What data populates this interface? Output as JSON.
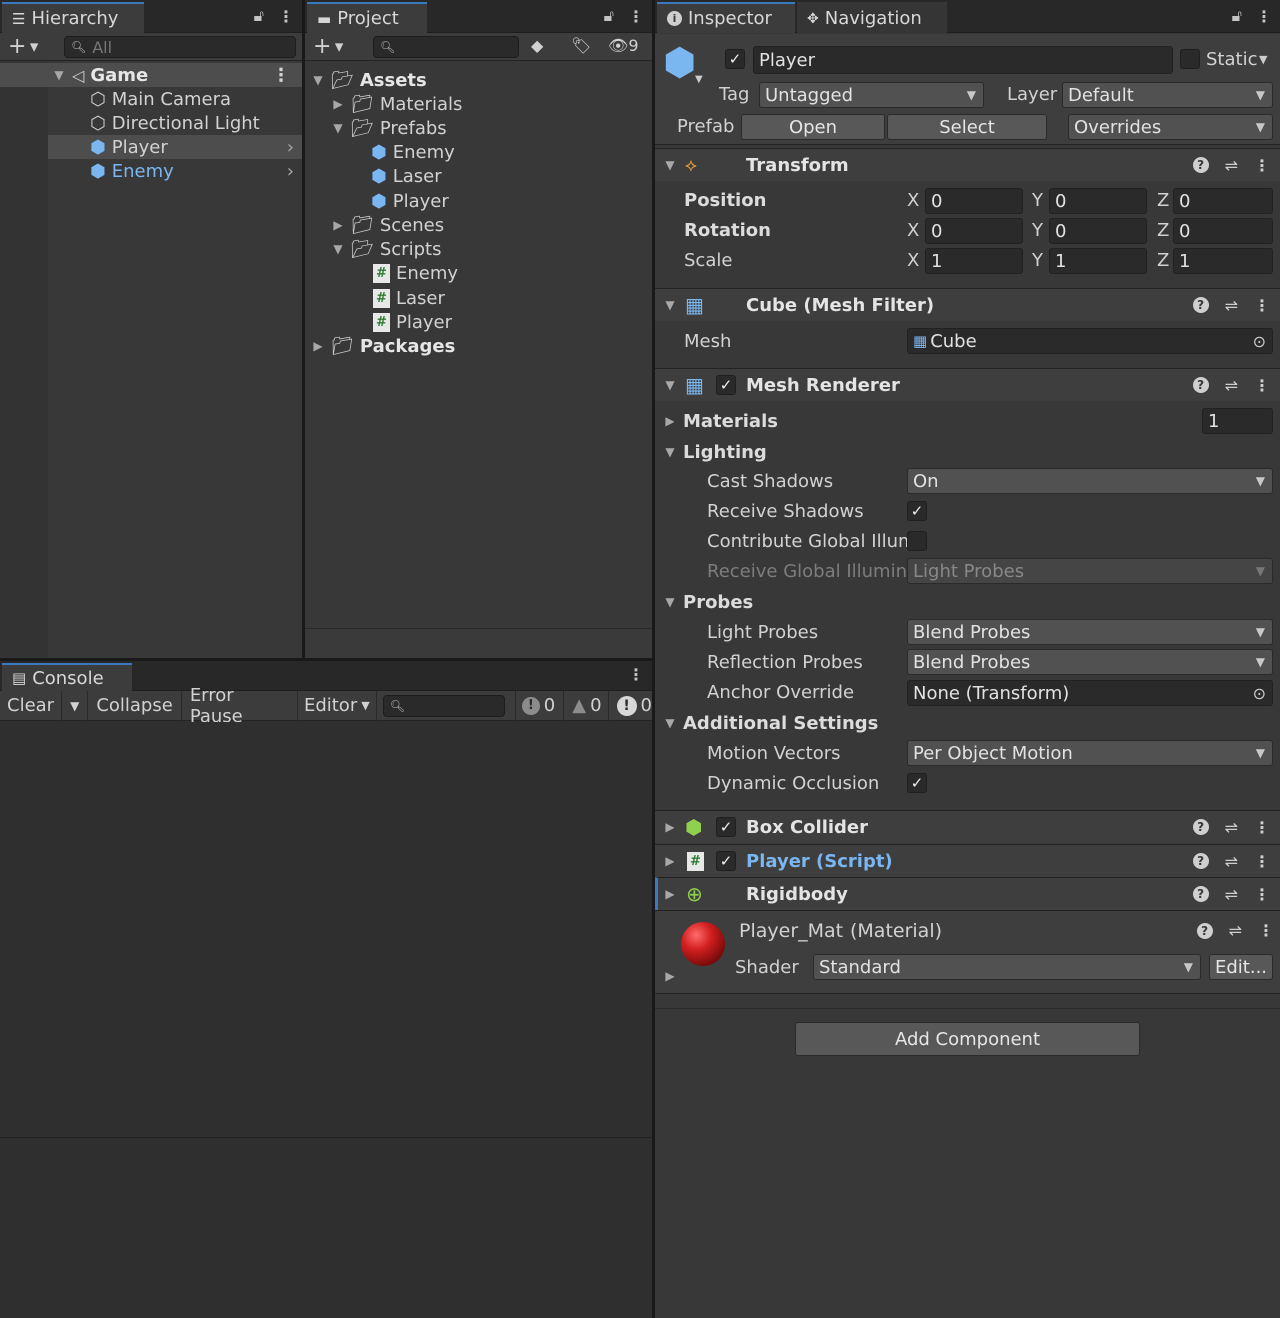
{
  "hierarchy": {
    "tab_label": "Hierarchy",
    "search_placeholder": "All",
    "scene": "Game",
    "items": [
      "Main Camera",
      "Directional Light",
      "Player",
      "Enemy"
    ]
  },
  "project": {
    "tab_label": "Project",
    "hidden_count": "9",
    "tree": {
      "assets": "Assets",
      "materials": "Materials",
      "prefabs": "Prefabs",
      "prefab_items": [
        "Enemy",
        "Laser",
        "Player"
      ],
      "scenes": "Scenes",
      "scripts": "Scripts",
      "script_items": [
        "Enemy",
        "Laser",
        "Player"
      ],
      "packages": "Packages"
    }
  },
  "console": {
    "tab_label": "Console",
    "clear": "Clear",
    "collapse": "Collapse",
    "error_pause": "Error Pause",
    "editor": "Editor",
    "info_count": "0",
    "warning_count": "0",
    "error_count": "0"
  },
  "inspector": {
    "tab_label": "Inspector",
    "nav_tab_label": "Navigation",
    "object_name": "Player",
    "static_label": "Static",
    "tag_label": "Tag",
    "tag_value": "Untagged",
    "layer_label": "Layer",
    "layer_value": "Default",
    "prefab_label": "Prefab",
    "open_btn": "Open",
    "select_btn": "Select",
    "overrides_btn": "Overrides",
    "transform": {
      "title": "Transform",
      "rows": [
        {
          "label": "Position",
          "x": "0",
          "y": "0",
          "z": "0"
        },
        {
          "label": "Rotation",
          "x": "0",
          "y": "0",
          "z": "0"
        },
        {
          "label": "Scale",
          "x": "1",
          "y": "1",
          "z": "1"
        }
      ],
      "axis": {
        "x": "X",
        "y": "Y",
        "z": "Z"
      }
    },
    "mesh_filter": {
      "title": "Cube (Mesh Filter)",
      "mesh_label": "Mesh",
      "mesh_value": "Cube"
    },
    "mesh_renderer": {
      "title": "Mesh Renderer",
      "materials_label": "Materials",
      "materials_count": "1",
      "lighting": "Lighting",
      "cast_shadows_label": "Cast Shadows",
      "cast_shadows_value": "On",
      "receive_shadows_label": "Receive Shadows",
      "contribute_gi_label": "Contribute Global Illumi",
      "receive_gi_label": "Receive Global Illumina",
      "receive_gi_value": "Light Probes",
      "probes": "Probes",
      "light_probes_label": "Light Probes",
      "light_probes_value": "Blend Probes",
      "reflection_probes_label": "Reflection Probes",
      "reflection_probes_value": "Blend Probes",
      "anchor_override_label": "Anchor Override",
      "anchor_override_value": "None (Transform)",
      "additional_settings": "Additional Settings",
      "motion_vectors_label": "Motion Vectors",
      "motion_vectors_value": "Per Object Motion",
      "dynamic_occlusion_label": "Dynamic Occlusion"
    },
    "box_collider": "Box Collider",
    "player_script": "Player (Script)",
    "rigidbody": "Rigidbody",
    "material": {
      "name": "Player_Mat",
      "type": "(Material)",
      "shader_label": "Shader",
      "shader_value": "Standard",
      "edit_btn": "Edit..."
    },
    "add_component": "Add Component"
  },
  "colors": {
    "accent": "#3a79bb",
    "prefab_blue": "#7ab6f0",
    "panel": "#383838"
  }
}
